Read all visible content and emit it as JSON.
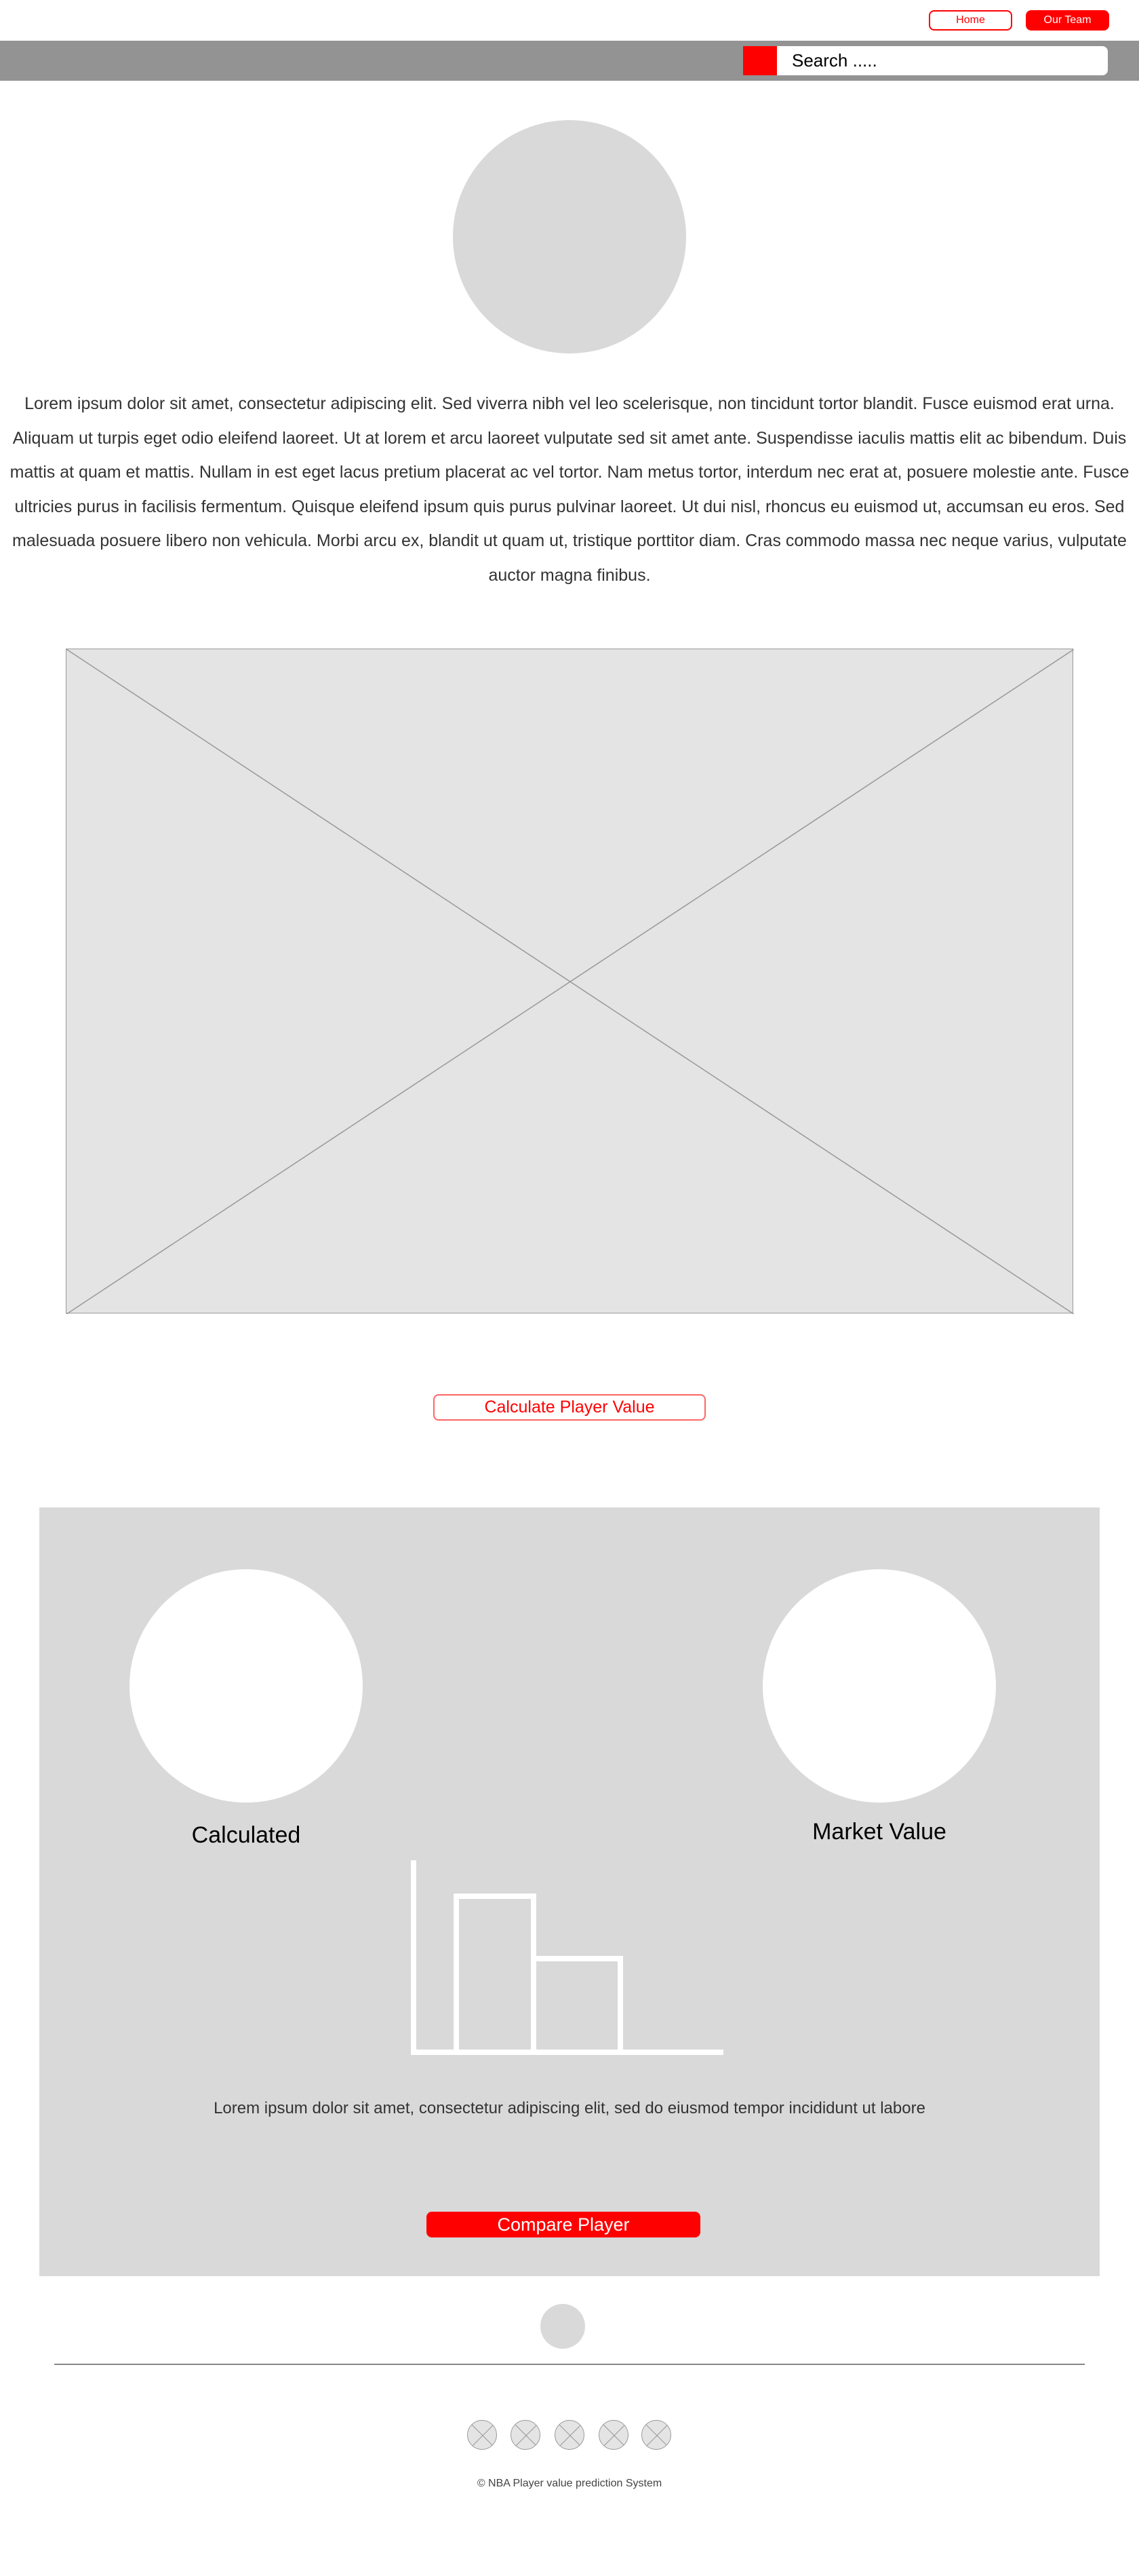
{
  "nav": {
    "home_label": "Home",
    "team_label": "Our Team"
  },
  "search": {
    "placeholder": "Search ....."
  },
  "intro": {
    "text": "Lorem ipsum dolor sit amet, consectetur adipiscing elit. Sed viverra nibh vel leo scelerisque, non tincidunt tortor blandit. Fusce euismod erat urna. Aliquam ut turpis eget odio eleifend laoreet. Ut at lorem et arcu laoreet vulputate sed sit amet ante. Suspendisse iaculis mattis elit ac bibendum. Duis mattis at quam et mattis. Nullam in est eget lacus pretium placerat ac vel tortor. Nam metus tortor, interdum nec erat at, posuere molestie ante. Fusce ultricies purus in facilisis fermentum. Quisque eleifend ipsum quis purus pulvinar laoreet. Ut dui nisl, rhoncus eu euismod ut, accumsan eu eros. Sed malesuada posuere libero non vehicula. Morbi arcu ex, blandit ut quam ut, tristique porttitor diam. Cras commodo massa nec neque varius, vulputate auctor magna finibus."
  },
  "calculate_label": "Calculate Player Value",
  "results": {
    "calculated_label": "Calculated",
    "market_label": "Market Value",
    "text": "Lorem ipsum dolor sit amet, consectetur adipiscing elit, sed do eiusmod tempor incididunt ut labore",
    "compare_label": "Compare Player"
  },
  "footer": {
    "copyright": "© NBA Player value prediction System",
    "social_count": 5
  },
  "colors": {
    "accent": "#ff0000",
    "bar": "#949393",
    "panel": "#d9d9d9"
  }
}
